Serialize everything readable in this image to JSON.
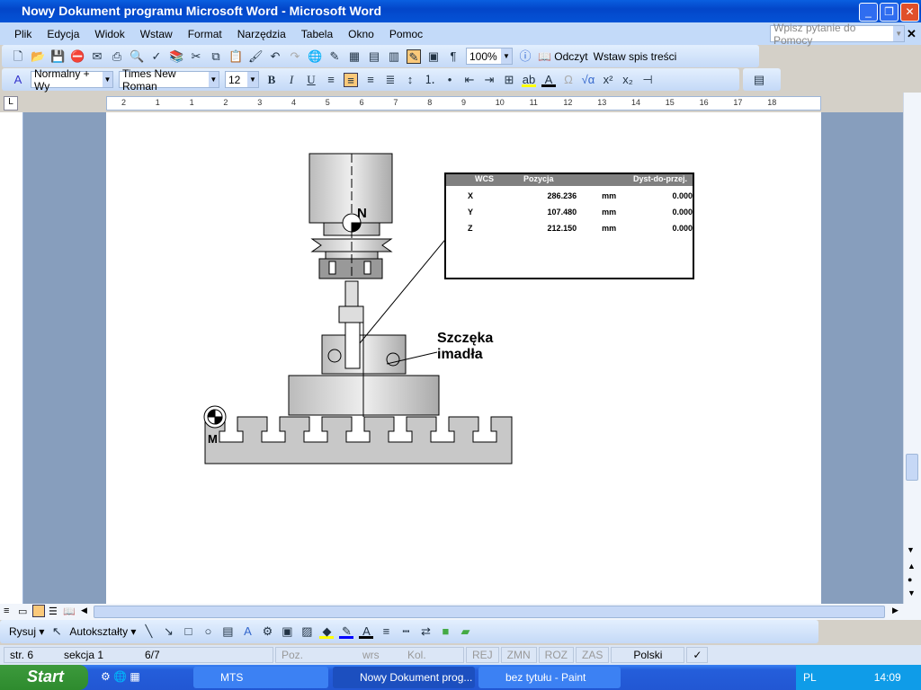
{
  "window": {
    "title": "Nowy Dokument programu Microsoft Word - Microsoft Word"
  },
  "menu": [
    "Plik",
    "Edycja",
    "Widok",
    "Wstaw",
    "Format",
    "Narzędzia",
    "Tabela",
    "Okno",
    "Pomoc"
  ],
  "help_box": {
    "placeholder": "Wpisz pytanie do Pomocy"
  },
  "toolbar": {
    "zoom": "100%",
    "read_label": "Odczyt",
    "toc_label": "Wstaw spis treści"
  },
  "format": {
    "style": "Normalny + Wy",
    "font": "Times New Roman",
    "size": "12",
    "bold": "B",
    "italic": "I",
    "underline": "U"
  },
  "ruler": [
    "2",
    "1",
    "1",
    "2",
    "3",
    "4",
    "5",
    "6",
    "7",
    "8",
    "9",
    "10",
    "11",
    "12",
    "13",
    "14",
    "15",
    "16",
    "17",
    "18"
  ],
  "figure": {
    "label_line1": "Szczęka",
    "label_line2": "imadła",
    "n_marker": "N",
    "m_marker": "M"
  },
  "wcs": {
    "headers": [
      "WCS",
      "Pozycja",
      "Dyst-do-przej."
    ],
    "rows": [
      {
        "axis": "X",
        "pos": "286.236",
        "unit": "mm",
        "dist": "0.000"
      },
      {
        "axis": "Y",
        "pos": "107.480",
        "unit": "mm",
        "dist": "0.000"
      },
      {
        "axis": "Z",
        "pos": "212.150",
        "unit": "mm",
        "dist": "0.000"
      }
    ]
  },
  "drawing": {
    "draw_label": "Rysuj",
    "autoshapes_label": "Autokształty"
  },
  "status": {
    "page": "str. 6",
    "section": "sekcja 1",
    "pages": "6/7",
    "pos": "Poz.",
    "line": "wrs",
    "col": "Kol.",
    "rec": "REJ",
    "trk": "ZMN",
    "ext": "ROZ",
    "ovr": "ZAS",
    "lang": "Polski"
  },
  "taskbar": {
    "start": "Start",
    "items": [
      "MTS",
      "Nowy Dokument prog...",
      "bez tytułu - Paint"
    ],
    "lang": "PL",
    "clock": "14:09"
  }
}
